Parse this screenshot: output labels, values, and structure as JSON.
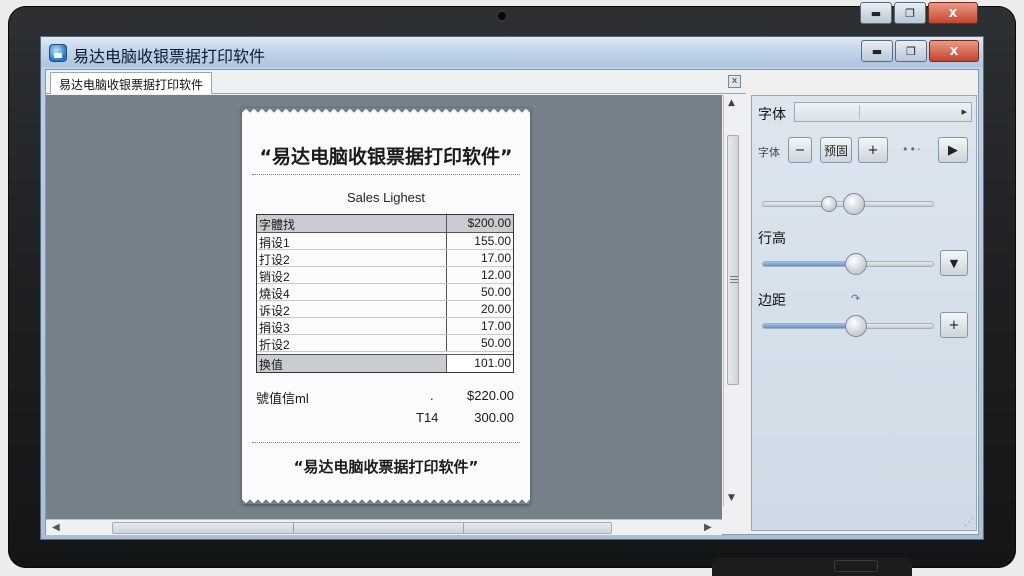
{
  "window": {
    "title": "易达电脑收银票据打印软件",
    "tab_label": "易达电脑收银票据打印软件",
    "minimize_glyph": "▬",
    "maximize_glyph": "❐",
    "close_glyph": "X",
    "tab_close_glyph": "x"
  },
  "receipt": {
    "title": "“易达电脑收银票据打印软件”",
    "subtitle": "Sales Lighest",
    "header": {
      "label": "字體找",
      "amount": "$200.00"
    },
    "rows": [
      {
        "label": "捐设1",
        "amount": "155.00"
      },
      {
        "label": "打设2",
        "amount": "17.00"
      },
      {
        "label": "销设2",
        "amount": "12.00"
      },
      {
        "label": "燒设4",
        "amount": "50.00"
      },
      {
        "label": "诉设2",
        "amount": "20.00"
      },
      {
        "label": "捐设3",
        "amount": "17.00"
      },
      {
        "label": "折设2",
        "amount": "50.00"
      }
    ],
    "footer_row": {
      "label": "换值",
      "amount": "101.00"
    },
    "summary": [
      {
        "label": "號值信ml",
        "mid": ".",
        "amount": "$220.00"
      },
      {
        "label": "",
        "mid": "T14",
        "amount": "300.00"
      }
    ],
    "footer": "“易达电脑收票据打印软件”"
  },
  "panel": {
    "font_label": "字体",
    "font_small_label": "字体",
    "minus_label": "−",
    "preview_label": "预固",
    "plus_label": "+",
    "dots": "••·",
    "play_label": "▶",
    "line_height_label": "行高",
    "margin_label": "边距",
    "dropdown_glyph": "▼",
    "margin_plus_glyph": "+",
    "font_slider_value": 0.45,
    "line_height_value": 0.55,
    "margin_value": 0.55
  }
}
